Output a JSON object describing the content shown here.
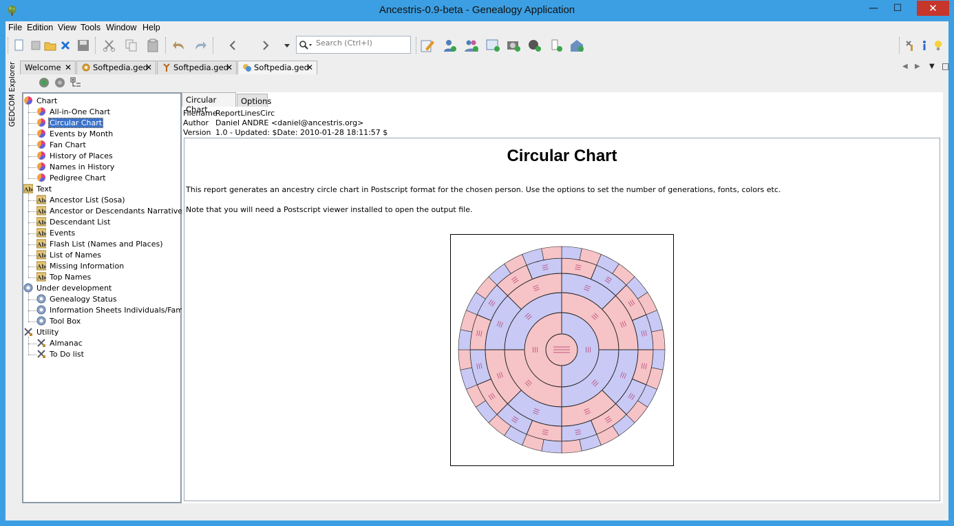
{
  "window": {
    "title": "Ancestris-0.9-beta - Genealogy Application",
    "minimize_glyph": "—",
    "maximize_glyph": "☐",
    "close_glyph": "✕"
  },
  "menubar": {
    "items": [
      "File",
      "Edition",
      "View",
      "Tools",
      "Window",
      "Help"
    ]
  },
  "toolbar": {
    "search_placeholder": "Search (Ctrl+I)",
    "icons": [
      "new-file-icon",
      "new-gedcom-icon",
      "open-folder-icon",
      "close-icon",
      "save-icon",
      "cut-icon",
      "copy-icon",
      "paste-icon",
      "undo-icon",
      "redo-icon",
      "back-icon",
      "forward-icon",
      "history-dropdown-icon",
      "search-icon",
      "edit-icon",
      "add-individual-icon",
      "add-family-icon",
      "add-note-icon",
      "add-media-icon",
      "add-source-icon",
      "add-submitter-icon",
      "add-repository-icon",
      "tools-icon",
      "info-icon",
      "tip-icon"
    ]
  },
  "side_panel": {
    "label": "GEDCOM Explorer"
  },
  "tabs": [
    {
      "label": "Welcome",
      "icon": ""
    },
    {
      "label": "Softpedia.ged",
      "icon": "gear-icon"
    },
    {
      "label": "Softpedia.ged",
      "icon": "tree-icon"
    },
    {
      "label": "Softpedia.ged",
      "icon": "report-icon"
    }
  ],
  "close_glyph": "✕",
  "tab_nav": {
    "prev": "◀",
    "next": "▶",
    "menu": "▼",
    "max": "□"
  },
  "tree": {
    "categories": [
      {
        "label": "Chart",
        "icon": "chart-icon",
        "items": [
          "All-in-One Chart",
          "Circular Chart",
          "Events by Month",
          "Fan Chart",
          "History of Places",
          "Names in History",
          "Pedigree Chart"
        ]
      },
      {
        "label": "Text",
        "icon": "text-icon",
        "items": [
          "Ancestor List (Sosa)",
          "Ancestor or Descendants Narrative",
          "Descendant List",
          "Events",
          "Flash List (Names and Places)",
          "List of Names",
          "Missing Information",
          "Top Names"
        ]
      },
      {
        "label": "Under development",
        "icon": "gear-icon",
        "items": [
          "Genealogy Status",
          "Information Sheets Individuals/Families",
          "Tool Box"
        ]
      },
      {
        "label": "Utility",
        "icon": "tools-icon",
        "items": [
          "Almanac",
          "To Do list"
        ]
      }
    ],
    "selected": "Circular Chart"
  },
  "report": {
    "tabs": [
      "Circular Chart",
      "Options"
    ],
    "meta": [
      {
        "key": "Filename",
        "value": "ReportLinesCirc"
      },
      {
        "key": "Author",
        "value": "Daniel ANDRE <daniel@ancestris.org>"
      },
      {
        "key": "Version",
        "value": "1.0 - Updated: $Date: 2010-01-28 18:11:57 $"
      }
    ],
    "title": "Circular Chart",
    "paragraphs": [
      "This report generates an ancestry circle chart in Postscript format for the chosen person. Use the options to set the number of generations, fonts, colors etc.",
      "Note that you will need a Postscript viewer installed to open the output file."
    ],
    "chart_preview": {
      "rings": 6,
      "colors": [
        "#f6c3c6",
        "#c8c9f4"
      ],
      "outline": "#222222",
      "label_color": "#b0306a"
    }
  },
  "colors": {
    "titlebar": "#3c9fe3",
    "close": "#c7362b",
    "selection": "#3a73cc"
  }
}
